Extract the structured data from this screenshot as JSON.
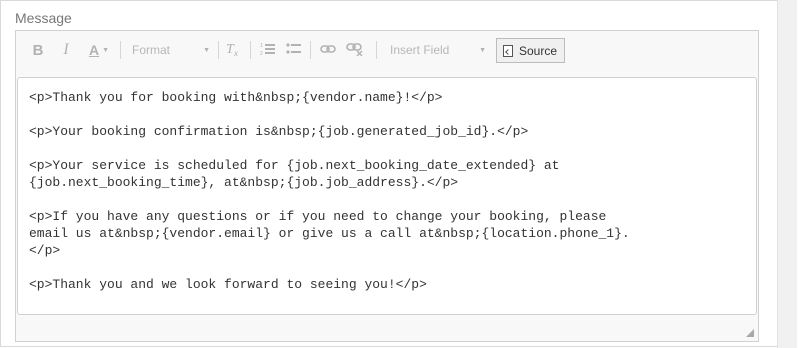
{
  "field": {
    "label": "Message"
  },
  "toolbar": {
    "bold_label": "B",
    "italic_label": "I",
    "font_color_label": "A",
    "format_label": "Format",
    "insert_field_label": "Insert Field",
    "source_label": "Source",
    "icons": [
      "bold-icon",
      "italic-icon",
      "font-color-icon",
      "remove-format-icon",
      "numbered-list-icon",
      "bulleted-list-icon",
      "link-icon",
      "unlink-icon",
      "source-document-icon"
    ]
  },
  "editor": {
    "mode": "source",
    "lines": [
      "<p>Thank you for booking with&nbsp;{vendor.name}!</p>",
      "",
      "<p>Your booking confirmation is&nbsp;{job.generated_job_id}.</p>",
      "",
      "<p>Your service is scheduled for {job.next_booking_date_extended} at",
      "{job.next_booking_time}, at&nbsp;{job.job_address}.</p>",
      "",
      "<p>If you have any questions or if you need to change your booking, please",
      "email us at&nbsp;{vendor.email} or give us a call at&nbsp;{location.phone_1}.",
      "</p>",
      "",
      "<p>Thank you and we look forward to seeing you!</p>"
    ]
  }
}
